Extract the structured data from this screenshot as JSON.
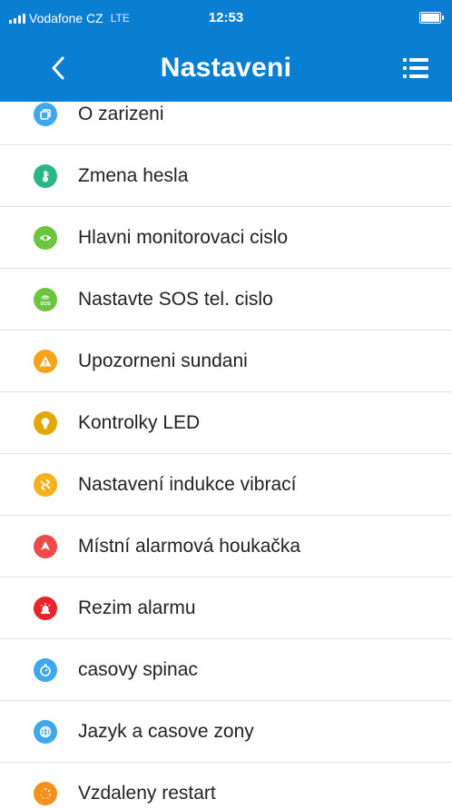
{
  "status_bar": {
    "carrier": "Vodafone CZ",
    "network": "LTE",
    "time": "12:53"
  },
  "nav": {
    "title": "Nastaveni",
    "back_icon": "chevron-left-icon",
    "menu_icon": "list-menu-icon"
  },
  "settings": {
    "items": [
      {
        "label": "O zarizeni",
        "icon": "device-info-icon",
        "color": "#3fa7ee"
      },
      {
        "label": "Zmena hesla",
        "icon": "thermometer-key-icon",
        "color": "#2bb685"
      },
      {
        "label": "Hlavni monitorovaci cislo",
        "icon": "eye-icon",
        "color": "#6cc43f"
      },
      {
        "label": "Nastavte SOS tel. cislo",
        "icon": "sos-icon",
        "color": "#6cc43f"
      },
      {
        "label": "Upozorneni sundani",
        "icon": "warning-icon",
        "color": "#f7a21b"
      },
      {
        "label": "Kontrolky LED",
        "icon": "lightbulb-icon",
        "color": "#e3a800"
      },
      {
        "label": "Nastavení indukce vibrací",
        "icon": "vibration-icon",
        "color": "#f7b21b"
      },
      {
        "label": "Místní alarmová houkačka",
        "icon": "siren-horn-icon",
        "color": "#ee4a4a"
      },
      {
        "label": "Rezim alarmu",
        "icon": "alarm-light-icon",
        "color": "#e6252b"
      },
      {
        "label": "casovy spinac",
        "icon": "stopwatch-icon",
        "color": "#3fa7ee"
      },
      {
        "label": "Jazyk a casove zony",
        "icon": "globe-icon",
        "color": "#3fa7ee"
      },
      {
        "label": "Vzdaleny restart",
        "icon": "restart-icon",
        "color": "#f78f1b"
      }
    ]
  }
}
